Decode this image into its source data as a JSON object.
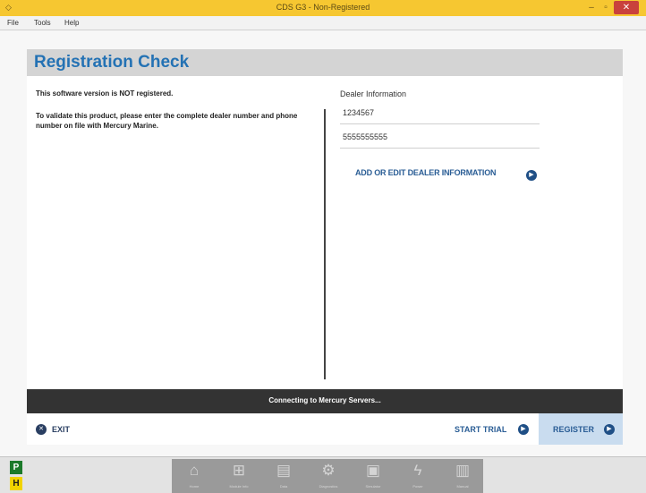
{
  "window": {
    "title": "CDS G3 - Non-Registered",
    "minimize_label": "–",
    "maximize_label": "▫",
    "close_label": "✕"
  },
  "menu": [
    "File",
    "Tools",
    "Help"
  ],
  "page": {
    "title": "Registration Check"
  },
  "message": {
    "not_registered": "This software version is NOT registered.",
    "instructions": "To validate this product, please enter the complete dealer number and phone number on file with Mercury Marine."
  },
  "dealer": {
    "label": "Dealer Information",
    "number": "1234567",
    "phone": "5555555555",
    "add_edit_label": "ADD OR EDIT DEALER INFORMATION"
  },
  "status": {
    "text": "Connecting to Mercury Servers..."
  },
  "buttons": {
    "exit": "EXIT",
    "start_trial": "START TRIAL",
    "register": "REGISTER"
  },
  "badges": {
    "p": "P",
    "h": "H"
  },
  "toolbar": {
    "items": [
      {
        "icon": "home-icon",
        "label": "Home"
      },
      {
        "icon": "module-icon",
        "label": "Module Info"
      },
      {
        "icon": "data-icon",
        "label": "Data"
      },
      {
        "icon": "diagnostics-icon",
        "label": "Diagnostics"
      },
      {
        "icon": "simulator-icon",
        "label": "Simulator"
      },
      {
        "icon": "power-icon",
        "label": "Power"
      },
      {
        "icon": "manual-icon",
        "label": "Manual"
      }
    ]
  },
  "colors": {
    "title_bar": "#f6c731",
    "accent": "#2472b4",
    "status_bar": "#333333",
    "register_bg": "#c9dcef"
  }
}
